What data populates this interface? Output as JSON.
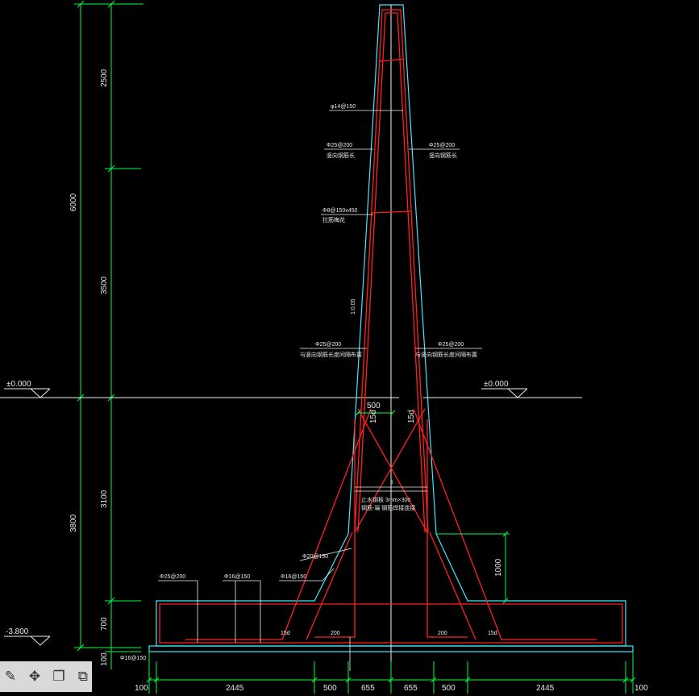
{
  "dims_left": {
    "d2500": "2500",
    "d6000": "6000",
    "d3500": "3500",
    "d3100": "3100",
    "d3800": "3800",
    "d700": "700",
    "d100": "100"
  },
  "dims_bottom": [
    "100",
    "2445",
    "500",
    "655",
    "655",
    "500",
    "2445",
    "100"
  ],
  "dims_wall": {
    "w500": "500",
    "d1000": "1000",
    "d15d_a": "15d",
    "d15d_b": "15d"
  },
  "levels": {
    "left_zero": "±0.000",
    "right_zero": "±0.000",
    "bottom": "-3.800"
  },
  "rebar_labels": {
    "top": "φ14@150",
    "left_vert": "Φ25@200",
    "left_vert_note": "竖向钢筋长",
    "right_vert": "Φ25@200",
    "right_vert_note": "竖向钢筋长",
    "tie": "Φ8@150x450",
    "tie_note": "拉筋梅花",
    "slope": "1:0.05",
    "left_mid": "Φ25@200",
    "left_mid_note": "与竖向钢筋长度间隔布置",
    "right_mid": "Φ25@200",
    "right_mid_note": "与竖向钢筋长度间隔布置",
    "cross_a": "止水钢板 3mm×300",
    "cross_b": "钢筋-端  钢筋焊接连接",
    "haunch": "Φ20@150",
    "base_left": "Φ25@200",
    "base_mid": "Φ16@150",
    "base_mid2": "Φ16@150",
    "small_note": "Φ16@150",
    "l15d_left": "15d",
    "l15d_right": "15d",
    "l200_left": "200",
    "l200_right": "200",
    "sub": "5"
  },
  "toolbar": [
    "edit-icon",
    "move-icon",
    "copy-icon",
    "paste-icon"
  ],
  "colors": {
    "rebar": "#ff2020",
    "concrete": "#40e8ff",
    "dimension": "#00ff40",
    "text": "#e8e8e8",
    "background": "#000000"
  }
}
